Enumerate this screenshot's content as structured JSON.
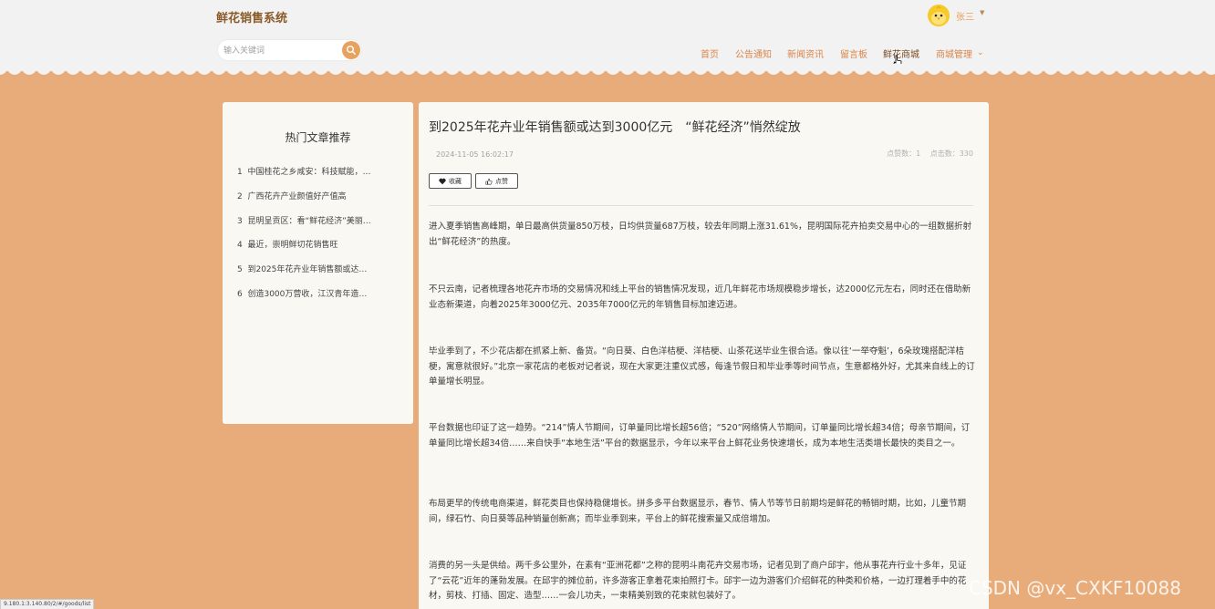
{
  "header": {
    "site_title": "鲜花销售系统",
    "search_placeholder": "输入关键词",
    "username": "张三",
    "nav": [
      {
        "label": "首页"
      },
      {
        "label": "公告通知"
      },
      {
        "label": "新闻资讯"
      },
      {
        "label": "留言板"
      },
      {
        "label": "鲜花商城"
      },
      {
        "label": "商城管理"
      }
    ]
  },
  "sidebar": {
    "title": "热门文章推荐",
    "items": [
      {
        "index": "1",
        "text": "中国桂花之乡咸安：科技赋能，…"
      },
      {
        "index": "2",
        "text": "广西花卉产业颜值好产值高"
      },
      {
        "index": "3",
        "text": "昆明呈贡区：看“鲜花经济”美丽…"
      },
      {
        "index": "4",
        "text": "最近，崇明鲜切花销售旺"
      },
      {
        "index": "5",
        "text": "到2025年花卉业年销售额或达…"
      },
      {
        "index": "6",
        "text": "创造3000万营收，江汉青年造…"
      }
    ]
  },
  "article": {
    "title": "到2025年花卉业年销售额或达到3000亿元　“鲜花经济”悄然绽放",
    "date": "2024-11-05 16:02:17",
    "likes_label": "点赞数：",
    "likes": "1",
    "clicks_label": "点击数：",
    "clicks": "330",
    "favorite_label": "收藏",
    "like_label": "点赞",
    "paragraphs": [
      "进入夏季销售高峰期，单日最高供货量850万枝，日均供货量687万枝，较去年同期上涨31.61%，昆明国际花卉拍卖交易中心的一组数据折射出“鲜花经济”的热度。",
      "不只云南，记者梳理各地花卉市场的交易情况和线上平台的销售情况发现，近几年鲜花市场规模稳步增长，达2000亿元左右，同时还在借助新业态新渠道，向着2025年3000亿元、2035年7000亿元的年销售目标加速迈进。",
      "毕业季到了，不少花店都在抓紧上新、备货。“向日葵、白色洋桔梗、洋桔梗、山茶花送毕业生很合适。像以往‘一举夺魁’，6朵玫瑰搭配洋桔梗，寓意就很好。”北京一家花店的老板对记者说，现在大家更注重仪式感，每逢节假日和毕业季等时间节点，生意都格外好，尤其来自线上的订单量增长明显。",
      "平台数据也印证了这一趋势。“214”情人节期间，订单量同比增长超56倍；“520”网络情人节期间，订单量同比增长超34倍；母亲节期间，订单量同比增长超34倍……来自快手“本地生活”平台的数据显示，今年以来平台上鲜花业务快速增长，成为本地生活类增长最快的类目之一。",
      "布局更早的传统电商渠道，鲜花类目也保持稳健增长。拼多多平台数据显示，春节、情人节等节日前期均是鲜花的畅销时期，比如，儿童节期间，绿石竹、向日葵等品种销量创新高；而毕业季到来，平台上的鲜花搜索量又成倍增加。",
      "消费的另一头是供给。两千多公里外，在素有“亚洲花都”之称的昆明斗南花卉交易市场，记者见到了商户邱宇，他从事花卉行业十多年，见证了“云花”近年的蓬勃发展。在邱宇的摊位前，许多游客正拿着花束拍照打卡。邱宇一边为游客们介绍鲜花的种类和价格，一边打理着手中的花材，剪枝、打插、固定、造型……一会儿功夫，一束精美别致的花束就包装好了。"
    ]
  },
  "watermark": "CSDN @vx_CXKF10088",
  "status_url": "9.180.1:3.140.80/2/#/goods/list",
  "colors": {
    "background": "#e8ac7a",
    "accent": "#e8a25f",
    "header": "#f2f2f2"
  }
}
